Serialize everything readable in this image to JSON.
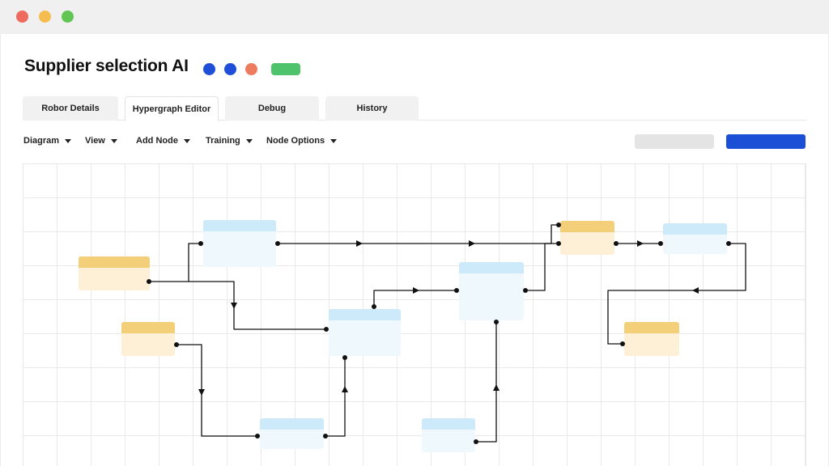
{
  "window": {
    "controls": [
      "close",
      "minimize",
      "maximize"
    ]
  },
  "header": {
    "title": "Supplier selection AI",
    "status_dots": [
      "#1f4ed8",
      "#1f4ed8",
      "#ee7b60"
    ],
    "status_pill_color": "#4fc36b"
  },
  "tabs": [
    {
      "label": "Robor Details",
      "active": false
    },
    {
      "label": "Hypergraph Editor",
      "active": true
    },
    {
      "label": "Debug",
      "active": false
    },
    {
      "label": "History",
      "active": false
    }
  ],
  "menu": [
    {
      "label": "Diagram"
    },
    {
      "label": "View"
    },
    {
      "label": "Add Node"
    },
    {
      "label": "Training"
    },
    {
      "label": "Node Options"
    }
  ],
  "colors": {
    "light_red": "#ee6a5e",
    "light_yellow": "#f5bd4f",
    "light_green": "#61c554",
    "primary": "#1a4fd6",
    "secondary": "#e4e4e4",
    "input_node_header": "#f4cf79",
    "input_node_body": "#fdf0d6",
    "process_node_header": "#cdeafb",
    "process_node_body": "#eef8fd",
    "connector": "#111111"
  },
  "graph": {
    "nodes": [
      {
        "id": "y1",
        "kind": "input"
      },
      {
        "id": "y2",
        "kind": "input"
      },
      {
        "id": "y3",
        "kind": "input"
      },
      {
        "id": "y4",
        "kind": "input"
      },
      {
        "id": "b1",
        "kind": "process"
      },
      {
        "id": "b2",
        "kind": "process"
      },
      {
        "id": "b3",
        "kind": "process"
      },
      {
        "id": "b4",
        "kind": "process"
      },
      {
        "id": "b5",
        "kind": "process"
      },
      {
        "id": "b6",
        "kind": "process"
      }
    ],
    "edges": [
      {
        "from": "y1",
        "to": "b1"
      },
      {
        "from": "y1",
        "to": "b2"
      },
      {
        "from": "b1",
        "to": "b6"
      },
      {
        "from": "y2",
        "to": "b4"
      },
      {
        "from": "b4",
        "to": "b2"
      },
      {
        "from": "b2",
        "to": "b3"
      },
      {
        "from": "b3",
        "to": "y3"
      },
      {
        "from": "b5",
        "to": "b3"
      },
      {
        "from": "y3",
        "to": "b6"
      },
      {
        "from": "b6",
        "to": "y4"
      }
    ]
  }
}
